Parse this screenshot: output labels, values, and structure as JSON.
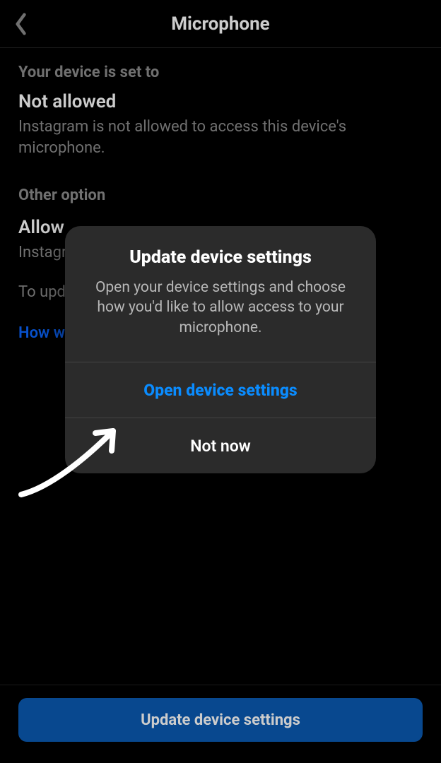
{
  "header": {
    "title": "Microphone"
  },
  "status": {
    "section_label": "Your device is set to",
    "title": "Not allowed",
    "description": "Instagram is not allowed to access this device's microphone."
  },
  "other": {
    "section_label": "Other option",
    "title": "Allow",
    "description": "Instagram can access this device's microphone.",
    "hint": "To update this, open your device settings.",
    "link": "How will my microphone be used?"
  },
  "bottom": {
    "button": "Update device settings"
  },
  "dialog": {
    "title": "Update device settings",
    "text": "Open your device settings and choose how you'd like to allow access to your microphone.",
    "primary": "Open device settings",
    "secondary": "Not now"
  }
}
